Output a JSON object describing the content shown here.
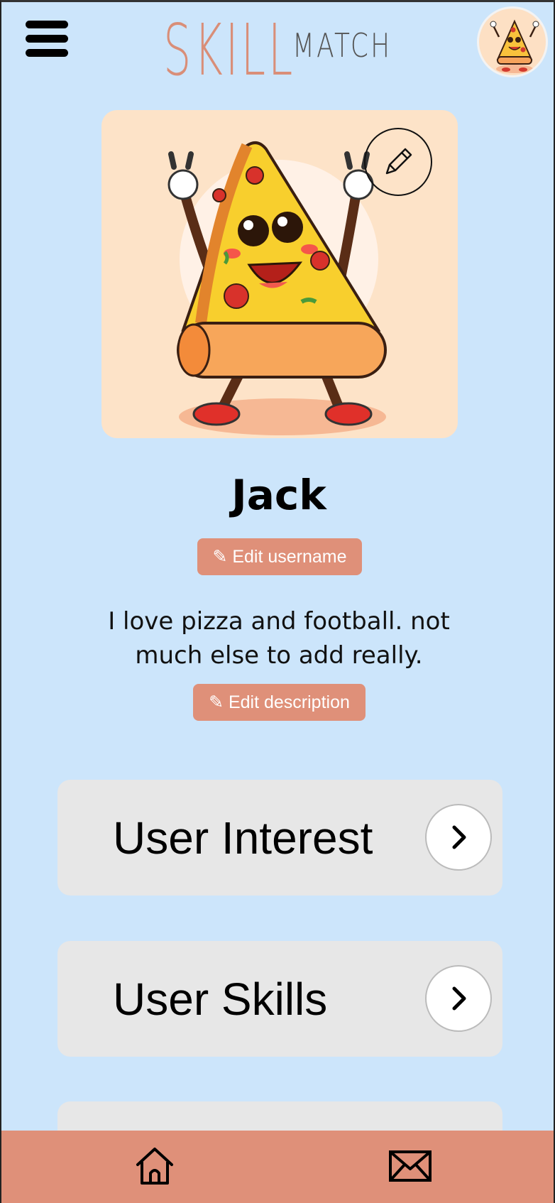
{
  "header": {
    "menu_icon": "hamburger-menu-icon",
    "logo_skill": "SKILL",
    "logo_match": "MATCH",
    "avatar_icon": "pizza-avatar"
  },
  "profile": {
    "picture_icon": "pizza-mascot",
    "edit_picture_icon": "pencil-icon",
    "username": "Jack",
    "edit_username_label": "✎ Edit username",
    "description": "I love pizza and football. not much else to add really.",
    "edit_description_label": "✎ Edit description"
  },
  "sections": [
    {
      "label": "User Interest",
      "icon": "chevron-right-icon"
    },
    {
      "label": "User Skills",
      "icon": "chevron-right-icon"
    },
    {
      "label": "",
      "icon": ""
    }
  ],
  "bottom_nav": {
    "home_icon": "home-icon",
    "mail_icon": "mail-icon"
  },
  "colors": {
    "background": "#cce5fb",
    "accent": "#df9079",
    "card": "#e7e7e7",
    "profile_bg": "#fde3c8"
  }
}
